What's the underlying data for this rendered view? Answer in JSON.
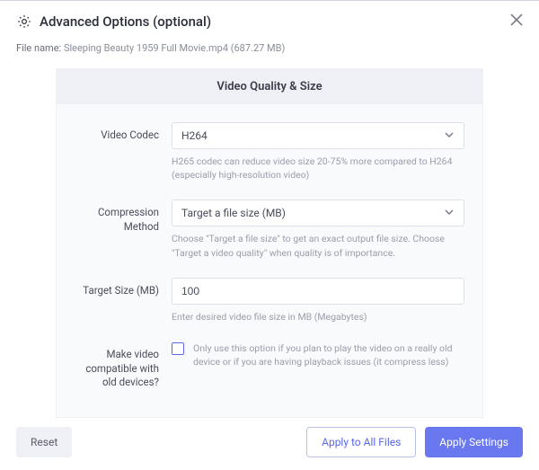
{
  "header": {
    "title": "Advanced Options (optional)"
  },
  "file": {
    "label": "File name:",
    "value": "Sleeping Beauty 1959 Full Movie.mp4 (687.27 MB)"
  },
  "panel": {
    "title": "Video Quality & Size",
    "codec": {
      "label": "Video Codec",
      "value": "H264",
      "hint": "H265 codec can reduce video size 20-75% more compared to H264 (especially high-resolution video)"
    },
    "method": {
      "label": "Compression Method",
      "value": "Target a file size (MB)",
      "hint": "Choose \"Target a file size\" to get an exact output file size. Choose \"Target a video quality\" when quality is of importance."
    },
    "target": {
      "label": "Target Size (MB)",
      "value": "100",
      "hint": "Enter desired video file size in MB (Megabytes)"
    },
    "compat": {
      "label": "Make video compatible with old devices?",
      "text": "Only use this option if you plan to play the video on a really old device or if you are having playback issues (it compress less)"
    }
  },
  "footer": {
    "reset": "Reset",
    "apply_all": "Apply to All Files",
    "apply": "Apply Settings"
  }
}
